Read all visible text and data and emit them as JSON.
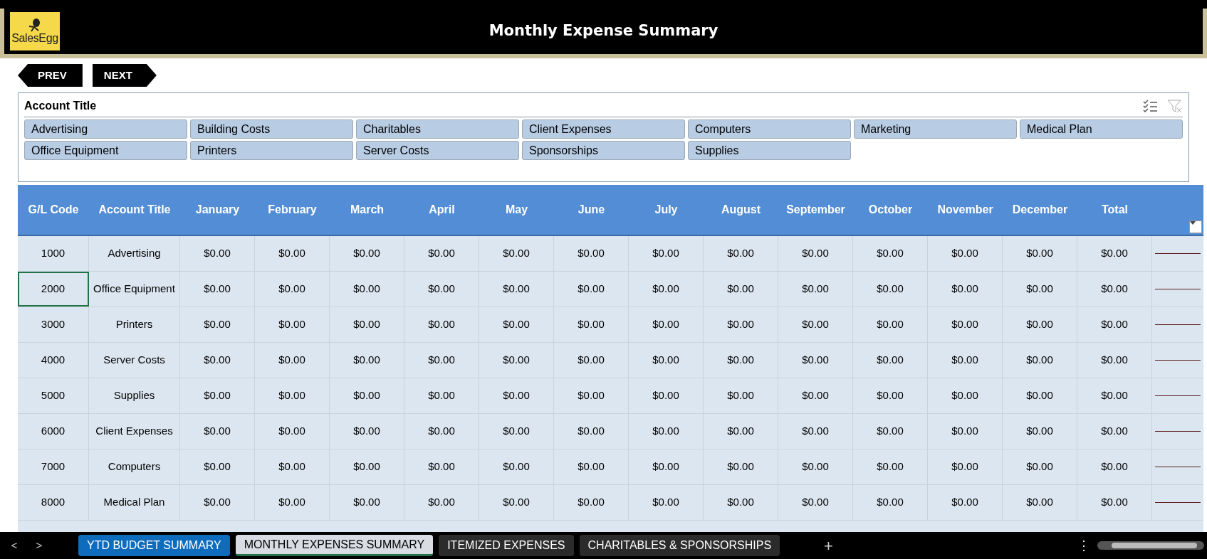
{
  "banner": {
    "logo": "SalesEgg",
    "title": "Monthly Expense Summary"
  },
  "nav_buttons": [
    {
      "kind": "prev",
      "label": "PREV"
    },
    {
      "kind": "next",
      "label": "NEXT"
    }
  ],
  "slicer": {
    "title": "Account Title",
    "items": [
      {
        "label": "Advertising",
        "selected": true
      },
      {
        "label": "Building Costs",
        "selected": true
      },
      {
        "label": "Charitables",
        "selected": true
      },
      {
        "label": "Client Expenses",
        "selected": true
      },
      {
        "label": "Computers",
        "selected": true
      },
      {
        "label": "Marketing",
        "selected": true
      },
      {
        "label": "Medical Plan",
        "selected": true
      },
      {
        "label": "Office Equipment",
        "selected": true
      },
      {
        "label": "Printers",
        "selected": true
      },
      {
        "label": "Server Costs",
        "selected": true
      },
      {
        "label": "Sponsorships",
        "selected": true
      },
      {
        "label": "Supplies",
        "selected": true
      }
    ]
  },
  "table": {
    "columns": [
      "G/L Code",
      "Account Title",
      "January",
      "February",
      "March",
      "April",
      "May",
      "June",
      "July",
      "August",
      "September",
      "October",
      "November",
      "December",
      "Total"
    ],
    "rows": [
      {
        "selected": false,
        "cells": [
          "1000",
          "Advertising",
          "$0.00",
          "$0.00",
          "$0.00",
          "$0.00",
          "$0.00",
          "$0.00",
          "$0.00",
          "$0.00",
          "$0.00",
          "$0.00",
          "$0.00",
          "$0.00",
          "$0.00"
        ]
      },
      {
        "selected": true,
        "cells": [
          "2000",
          "Office Equipment",
          "$0.00",
          "$0.00",
          "$0.00",
          "$0.00",
          "$0.00",
          "$0.00",
          "$0.00",
          "$0.00",
          "$0.00",
          "$0.00",
          "$0.00",
          "$0.00",
          "$0.00"
        ]
      },
      {
        "selected": false,
        "cells": [
          "3000",
          "Printers",
          "$0.00",
          "$0.00",
          "$0.00",
          "$0.00",
          "$0.00",
          "$0.00",
          "$0.00",
          "$0.00",
          "$0.00",
          "$0.00",
          "$0.00",
          "$0.00",
          "$0.00"
        ]
      },
      {
        "selected": false,
        "cells": [
          "4000",
          "Server Costs",
          "$0.00",
          "$0.00",
          "$0.00",
          "$0.00",
          "$0.00",
          "$0.00",
          "$0.00",
          "$0.00",
          "$0.00",
          "$0.00",
          "$0.00",
          "$0.00",
          "$0.00"
        ]
      },
      {
        "selected": false,
        "cells": [
          "5000",
          "Supplies",
          "$0.00",
          "$0.00",
          "$0.00",
          "$0.00",
          "$0.00",
          "$0.00",
          "$0.00",
          "$0.00",
          "$0.00",
          "$0.00",
          "$0.00",
          "$0.00",
          "$0.00"
        ]
      },
      {
        "selected": false,
        "cells": [
          "6000",
          "Client Expenses",
          "$0.00",
          "$0.00",
          "$0.00",
          "$0.00",
          "$0.00",
          "$0.00",
          "$0.00",
          "$0.00",
          "$0.00",
          "$0.00",
          "$0.00",
          "$0.00",
          "$0.00"
        ]
      },
      {
        "selected": false,
        "cells": [
          "7000",
          "Computers",
          "$0.00",
          "$0.00",
          "$0.00",
          "$0.00",
          "$0.00",
          "$0.00",
          "$0.00",
          "$0.00",
          "$0.00",
          "$0.00",
          "$0.00",
          "$0.00",
          "$0.00"
        ]
      },
      {
        "selected": false,
        "cells": [
          "8000",
          "Medical Plan",
          "$0.00",
          "$0.00",
          "$0.00",
          "$0.00",
          "$0.00",
          "$0.00",
          "$0.00",
          "$0.00",
          "$0.00",
          "$0.00",
          "$0.00",
          "$0.00",
          "$0.00"
        ]
      }
    ]
  },
  "sheet_bar": {
    "prev": "<",
    "next": ">",
    "tabs": [
      {
        "label": "YTD BUDGET SUMMARY",
        "selected": false,
        "color": "#0f6cbd"
      },
      {
        "label": "MONTHLY EXPENSES SUMMARY",
        "selected": true,
        "color": "#d9dde3"
      },
      {
        "label": "ITEMIZED EXPENSES",
        "selected": false,
        "color": "#2b2b2b"
      },
      {
        "label": "CHARITABLES & SPONSORSHIPS",
        "selected": false,
        "color": "#2b2b2b"
      }
    ],
    "add": "+",
    "more": "⋮"
  }
}
